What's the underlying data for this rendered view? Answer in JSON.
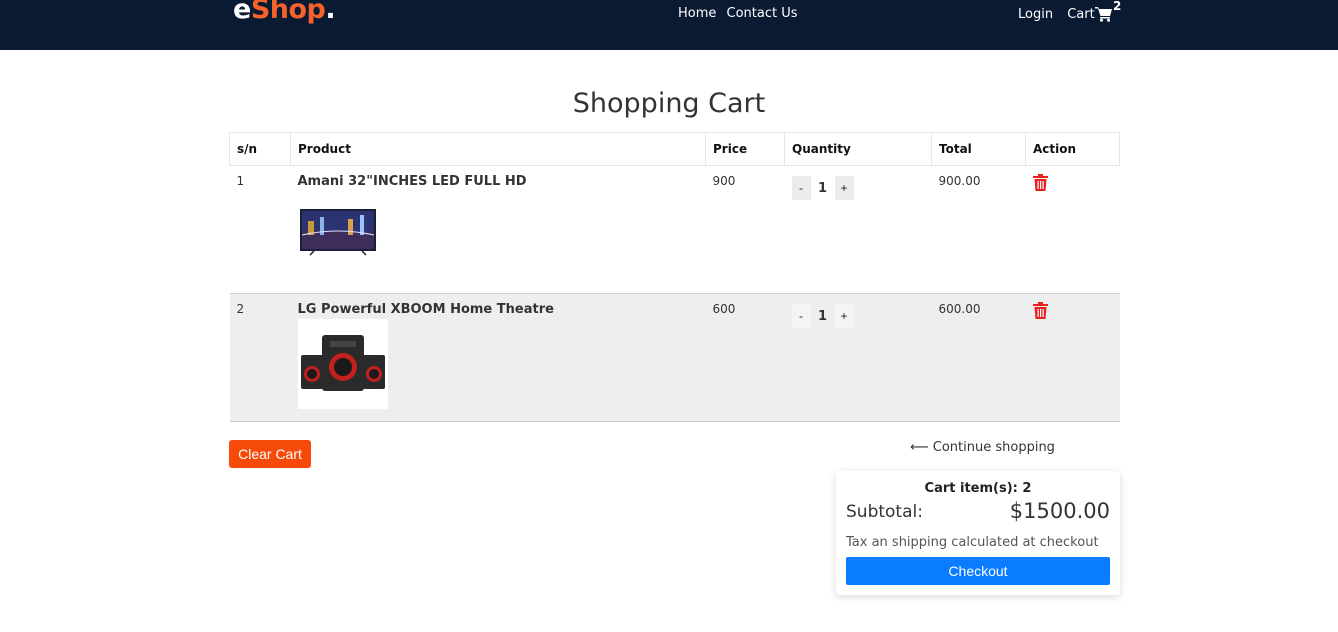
{
  "header": {
    "logo_e": "e",
    "logo_shop": "Shop",
    "logo_dot": ".",
    "nav": [
      "Home",
      "Contact Us"
    ],
    "login": "Login",
    "cart": "Cart",
    "cart_count": "2"
  },
  "page_title": "Shopping Cart",
  "table": {
    "headers": [
      "s/n",
      "Product",
      "Price",
      "Quantity",
      "Total",
      "Action"
    ],
    "rows": [
      {
        "sn": "1",
        "name": "Amani 32\"INCHES LED FULL HD",
        "price": "900",
        "qty": "1",
        "total": "900.00",
        "image": "tv-image"
      },
      {
        "sn": "2",
        "name": "LG Powerful XBOOM Home Theatre",
        "price": "600",
        "qty": "1",
        "total": "600.00",
        "image": "speaker-image"
      }
    ],
    "minus": "-",
    "plus": "+"
  },
  "actions": {
    "clear_cart": "Clear Cart",
    "continue": "⟵ Continue shopping"
  },
  "summary": {
    "items_label": "Cart item(s): 2",
    "subtotal_label": "Subtotal:",
    "subtotal_value": "$1500.00",
    "tax_note": "Tax an shipping calculated at checkout",
    "checkout": "Checkout"
  },
  "colors": {
    "header_bg": "#0b1a33",
    "brand_orange": "#f7612a",
    "clear_btn": "#f54a0a",
    "checkout_btn": "#0a7cff",
    "trash_red": "#e8201b"
  }
}
